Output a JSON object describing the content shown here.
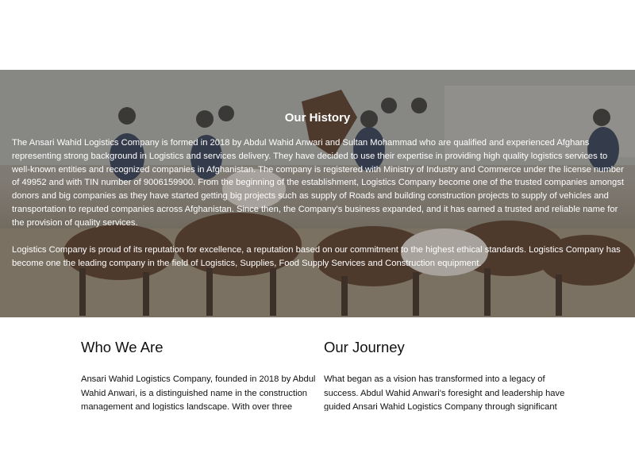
{
  "history": {
    "title": "Our History",
    "paragraph1": "The Ansari Wahid Logistics Company is formed in 2018 by Abdul Wahid Anwari and Sultan Mohammad who are qualified and experienced Afghans representing strong background in Logistics and services delivery. They have decided to use their expertise in providing high quality logistics services to well-known entities and recognized companies in Afghanistan. The company is registered with Ministry of Industry and Commerce under the license number of 49952 and with TIN number of 9006159900. From the beginning of the establishment, Logistics Company become one of the trusted companies amongst donors and big companies as they have started getting big projects such as supply of Roads and building construction projects to supply of vehicles and transportation to reputed companies across Afghanistan. Since then, the Company's business expanded, and it has earned a trusted and reliable name for the provision of quality services.",
    "paragraph2": "Logistics Company is proud of its reputation for excellence, a reputation based on our commitment to the highest ethical standards.  Logistics Company has become one the leading company in the field of Logistics, Supplies, Food Supply Services and Construction equipment."
  },
  "who_we_are": {
    "heading": "Who We Are",
    "text": "Ansari Wahid Logistics Company, founded in 2018 by Abdul Wahid Anwari, is a distinguished name in the construction management and logistics landscape. With over three decades of experience, our team has consistently delivered"
  },
  "our_journey": {
    "heading": "Our Journey",
    "text": "What began as a vision has transformed into a legacy of success. Abdul Wahid Anwari's foresight and leadership have guided Ansari Wahid Logistics Company through significant milestones, establishing us as a reliable and innovative force"
  },
  "colors": {
    "overlay": "#3c3732",
    "heading_text": "#111111",
    "hero_text": "#ffffff"
  }
}
